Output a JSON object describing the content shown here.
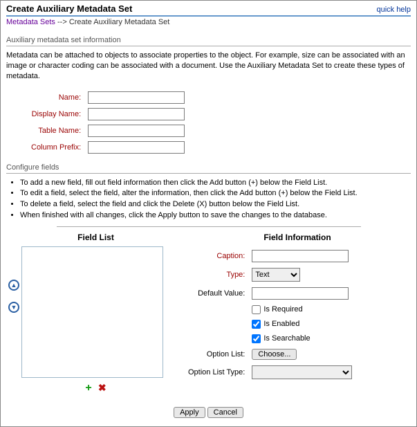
{
  "header": {
    "title": "Create Auxiliary Metadata Set",
    "quick_help": "quick help"
  },
  "breadcrumb": {
    "link": "Metadata Sets",
    "sep": " --> ",
    "current": "Create Auxiliary Metadata Set"
  },
  "section_info": {
    "title": "Auxiliary metadata set information",
    "desc": "Metadata can be attached to objects to associate properties to the object. For example, size can be associated with an image or character coding can be associated with a document. Use the Auxiliary Metadata Set to create these types of metadata.",
    "fields": {
      "name_label": "Name:",
      "display_name_label": "Display Name:",
      "table_name_label": "Table Name:",
      "column_prefix_label": "Column Prefix:",
      "name_value": "",
      "display_name_value": "",
      "table_name_value": "",
      "column_prefix_value": ""
    }
  },
  "section_fields": {
    "title": "Configure fields",
    "bullets": [
      "To add a new field, fill out field information then click the Add button (+) below the Field List.",
      "To edit a field, select the field, alter the information, then click the Add button (+) below the Field List.",
      "To delete a field, select the field and click the Delete (X) button below the Field List.",
      "When finished with all changes, click the Apply button to save the changes to the database."
    ]
  },
  "field_list": {
    "heading": "Field List"
  },
  "field_info": {
    "heading": "Field Information",
    "caption_label": "Caption:",
    "caption_value": "",
    "type_label": "Type:",
    "type_value": "Text",
    "default_label": "Default Value:",
    "default_value": "",
    "is_required_label": "Is Required",
    "is_enabled_label": "Is Enabled",
    "is_searchable_label": "Is Searchable",
    "option_list_label": "Option List:",
    "choose_label": "Choose...",
    "option_list_type_label": "Option List Type:",
    "option_list_type_value": ""
  },
  "icons": {
    "up": "▲",
    "down": "▼",
    "plus": "+",
    "delete": "✖"
  },
  "actions": {
    "apply": "Apply",
    "cancel": "Cancel"
  }
}
